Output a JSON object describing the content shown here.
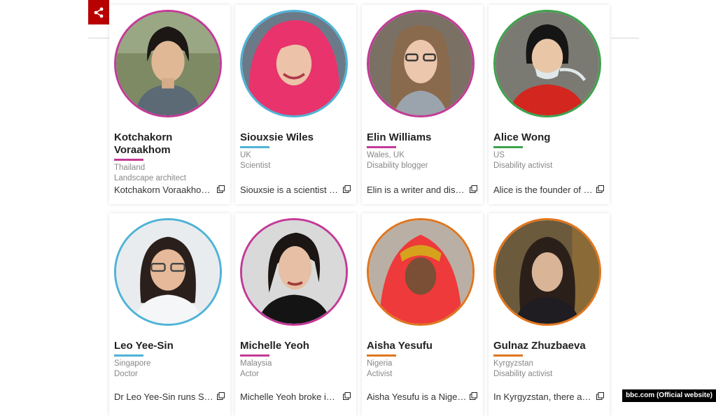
{
  "toolbar": {
    "share_icon": "share-icon"
  },
  "credit": "bbc.com (Official website)",
  "colors": {
    "pink": "#c33a97",
    "blue": "#4fb3d6",
    "green": "#3da34b",
    "orange": "#e0761e",
    "red": "#b80000"
  },
  "cards": [
    {
      "name": "Kotchakorn Voraakhom",
      "country": "Thailand",
      "role": "Landscape architect",
      "desc": "Kotchakorn Voraakhom is a landscape architect"
    },
    {
      "name": "Siouxsie Wiles",
      "country": "UK",
      "role": "Scientist",
      "desc": "Siouxsie is a scientist and science communicator"
    },
    {
      "name": "Elin Williams",
      "country": "Wales, UK",
      "role": "Disability blogger",
      "desc": "Elin is a writer and disability blogger"
    },
    {
      "name": "Alice Wong",
      "country": "US",
      "role": "Disability activist",
      "desc": "Alice is the founder of the Disability Visibility Project"
    },
    {
      "name": "Leo Yee-Sin",
      "country": "Singapore",
      "role": "Doctor",
      "desc": "Dr Leo Yee-Sin runs Singapore's infectious diseases centre"
    },
    {
      "name": "Michelle Yeoh",
      "country": "Malaysia",
      "role": "Actor",
      "desc": "Michelle Yeoh broke into the film industry"
    },
    {
      "name": "Aisha Yesufu",
      "country": "Nigeria",
      "role": "Activist",
      "desc": "Aisha Yesufu is a Nigerian activist"
    },
    {
      "name": "Gulnaz Zhuzbaeva",
      "country": "Kyrgyzstan",
      "role": "Disability activist",
      "desc": "In Kyrgyzstan, there are thousands of people"
    }
  ]
}
